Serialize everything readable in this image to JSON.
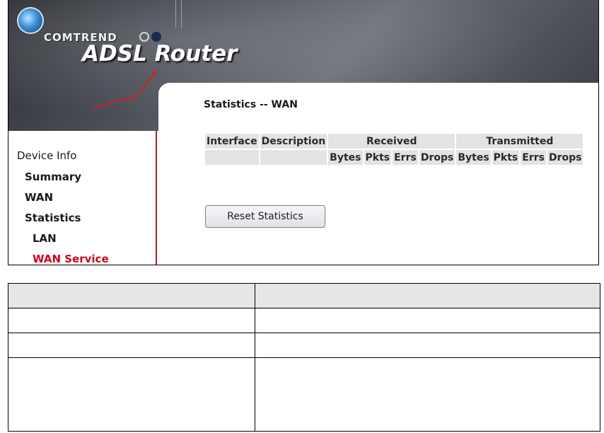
{
  "banner": {
    "brand": "COMTREND",
    "title": "ADSL Router"
  },
  "sidebar": {
    "items": [
      {
        "label": "Device Info"
      },
      {
        "label": "Summary"
      },
      {
        "label": "WAN"
      },
      {
        "label": "Statistics"
      },
      {
        "label": "LAN"
      },
      {
        "label": "WAN Service"
      }
    ]
  },
  "page": {
    "title": "Statistics -- WAN"
  },
  "stats_table": {
    "headers": {
      "interface": "Interface",
      "description": "Description",
      "received": "Received",
      "transmitted": "Transmitted"
    },
    "subheaders": [
      "Bytes",
      "Pkts",
      "Errs",
      "Drops",
      "Bytes",
      "Pkts",
      "Errs",
      "Drops"
    ]
  },
  "buttons": {
    "reset": "Reset Statistics"
  },
  "colors": {
    "accent_red": "#d0021b",
    "table_cell": "#e3e3e3"
  }
}
